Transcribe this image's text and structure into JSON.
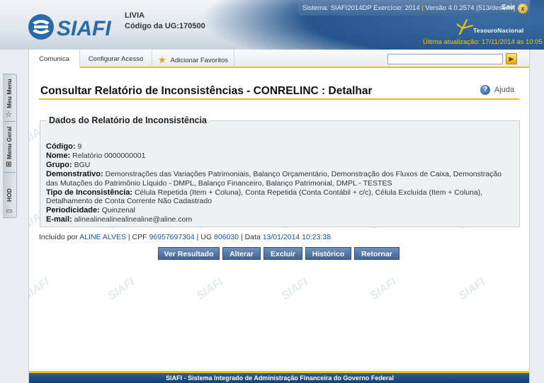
{
  "header": {
    "logo_text": "SIAFI",
    "user_name": "LIVIA",
    "ug_label": "Código da UG:",
    "ug_code": "170500",
    "system_info_left": "Sistema: SIAFI2014DP Exercício: 2014",
    "system_info_right": "Versão 4.0.2574 (513/desenv)",
    "exit_label": "Sair",
    "exit_icon": "close-icon",
    "tesouro_label": "TesouroNacional",
    "last_update": "Última atualização: 17/11/2014 às 10:05"
  },
  "side_tabs": [
    "Meu Menu",
    "Menu Geral",
    "HOD"
  ],
  "menu": {
    "items": [
      "Comunica",
      "Configurar Acesso",
      "Adicionar Favoritos"
    ],
    "search_placeholder": ""
  },
  "page": {
    "title": "Consultar Relatório de Inconsistências - CONRELINC : Detalhar",
    "help_label": "Ajuda",
    "section_title": "Dados do Relatório de Inconsistência",
    "fields": [
      {
        "label": "Código:",
        "value": "9"
      },
      {
        "label": "Nome:",
        "value": "Relatório 0000000001"
      },
      {
        "label": "Grupo:",
        "value": "BGU"
      },
      {
        "label": "Demonstrativo:",
        "value": "Demonstrações das Variações Patrimoniais, Balanço Orçamentário, Demonstração dos Fluxos de Caixa, Demonstração das Mutações do Patrimônio Líquido - DMPL, Balanço Financeiro, Balanço Patrimonial, DMPL - TESTES"
      },
      {
        "label": "Tipo de Inconsistência:",
        "value": "Célula Repetida (Item + Coluna), Conta Repetida (Conta Contábil + c/c), Célula Excluída (Item + Coluna), Detalhamento de Conta Corrente Não Cadastrado"
      },
      {
        "label": "Periodicidade:",
        "value": "Quinzenal"
      },
      {
        "label": "E-mail:",
        "value": "alinealinealinealinealine@aline.com"
      }
    ],
    "audit": {
      "prefix": "Incluído por",
      "user": "ALINE ALVES",
      "cpf_label": "| CPF",
      "cpf": "96957697304",
      "ug_label": "| UG",
      "ug": "806030",
      "date_label": "| Data",
      "date": "13/01/2014 10:23:38"
    },
    "buttons": [
      "Ver Resultado",
      "Alterar",
      "Excluir",
      "Histórico",
      "Retornar"
    ]
  },
  "footer": "SIAFI - Sistema Integrado de Administração Financeira do Governo Federal",
  "colors": {
    "accent": "#f2c200",
    "primary": "#24558c",
    "button": "#4f73a3"
  }
}
